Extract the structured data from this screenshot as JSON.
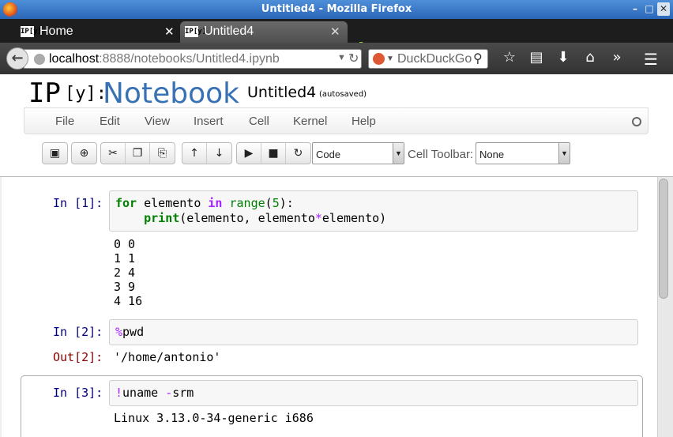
{
  "window": {
    "title": "Untitled4 - Mozilla Firefox"
  },
  "tabs": [
    {
      "label": "Home",
      "favicon": "IP[y]"
    },
    {
      "label": "Untitled4",
      "favicon": "IP[y]"
    }
  ],
  "address": {
    "host": "localhost",
    "path": ":8888/notebooks/Untitled4.ipynb"
  },
  "search": {
    "placeholder": "DuckDuckGo"
  },
  "ipython": {
    "logo_ip": "IP",
    "logo_y": "[y]:",
    "logo_notebook": "Notebook",
    "notebook_name": "Untitled4",
    "autosave": "(autosaved)"
  },
  "menu": [
    "File",
    "Edit",
    "View",
    "Insert",
    "Cell",
    "Kernel",
    "Help"
  ],
  "toolbar": {
    "cell_type": "Code",
    "cell_toolbar_label": "Cell Toolbar:",
    "cell_toolbar_value": "None"
  },
  "cells": [
    {
      "prompt": "In [1]:",
      "output_lines": [
        "0 0",
        "1 1",
        "2 4",
        "3 9",
        "4 16"
      ]
    },
    {
      "prompt": "In [2]:",
      "out_prompt": "Out[2]:",
      "output": "'/home/antonio'"
    },
    {
      "prompt": "In [3]:",
      "output": "Linux 3.13.0-34-generic i686"
    }
  ],
  "code_tokens": {
    "c1_for": "for",
    "c1_var": " elemento ",
    "c1_in": "in",
    "c1_range": " range",
    "c1_open": "(",
    "c1_num": "5",
    "c1_close": "):",
    "c1_indent": "    ",
    "c1_print": "print",
    "c1_args1": "(elemento, elemento",
    "c1_star": "*",
    "c1_args2": "elemento)",
    "c2_pct": "%",
    "c2_cmd": "pwd",
    "c3_bang": "!",
    "c3_cmd": "uname ",
    "c3_dash": "-",
    "c3_args": "srm"
  }
}
